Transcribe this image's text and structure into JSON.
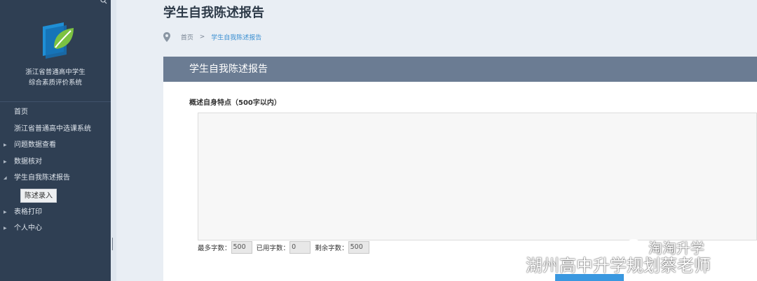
{
  "sidebar": {
    "system_name_line1": "浙江省普通高中学生",
    "system_name_line2": "综合素质评价系统",
    "nav": [
      {
        "label": "首页",
        "has_arrow": false
      },
      {
        "label": "浙江省普通高中选课系统",
        "has_arrow": false
      },
      {
        "label": "问题数据查看",
        "arrow": "▶"
      },
      {
        "label": "数据核对",
        "arrow": "▶"
      },
      {
        "label": "学生自我陈述报告",
        "arrow": "◢"
      },
      {
        "label": "陈述录入",
        "is_sub": true
      },
      {
        "label": "表格打印",
        "arrow": "▶"
      },
      {
        "label": "个人中心",
        "arrow": "▶"
      }
    ],
    "colors": {
      "background": "#2f3f53",
      "logo_blue": "#1f8fd6",
      "logo_green": "#7cc242"
    }
  },
  "main": {
    "page_title": "学生自我陈述报告",
    "breadcrumb": {
      "home": "首页",
      "separator": ">",
      "current": "学生自我陈述报告"
    },
    "panel": {
      "header": "学生自我陈述报告",
      "field_label": "概述自身特点（500字以内）",
      "textarea_value": "",
      "counts": {
        "max_label": "最多字数：",
        "max_value": "500",
        "used_label": "已用字数：",
        "used_value": "0",
        "remaining_label": "剩余字数：",
        "remaining_value": "500"
      }
    },
    "colors": {
      "panel_header": "#6b7c93",
      "accent": "#3a8fd1",
      "submit": "#3a98e0"
    }
  },
  "watermark": {
    "line1": "淘淘升学",
    "line2": "湖州高中升学规划蔡老师"
  }
}
